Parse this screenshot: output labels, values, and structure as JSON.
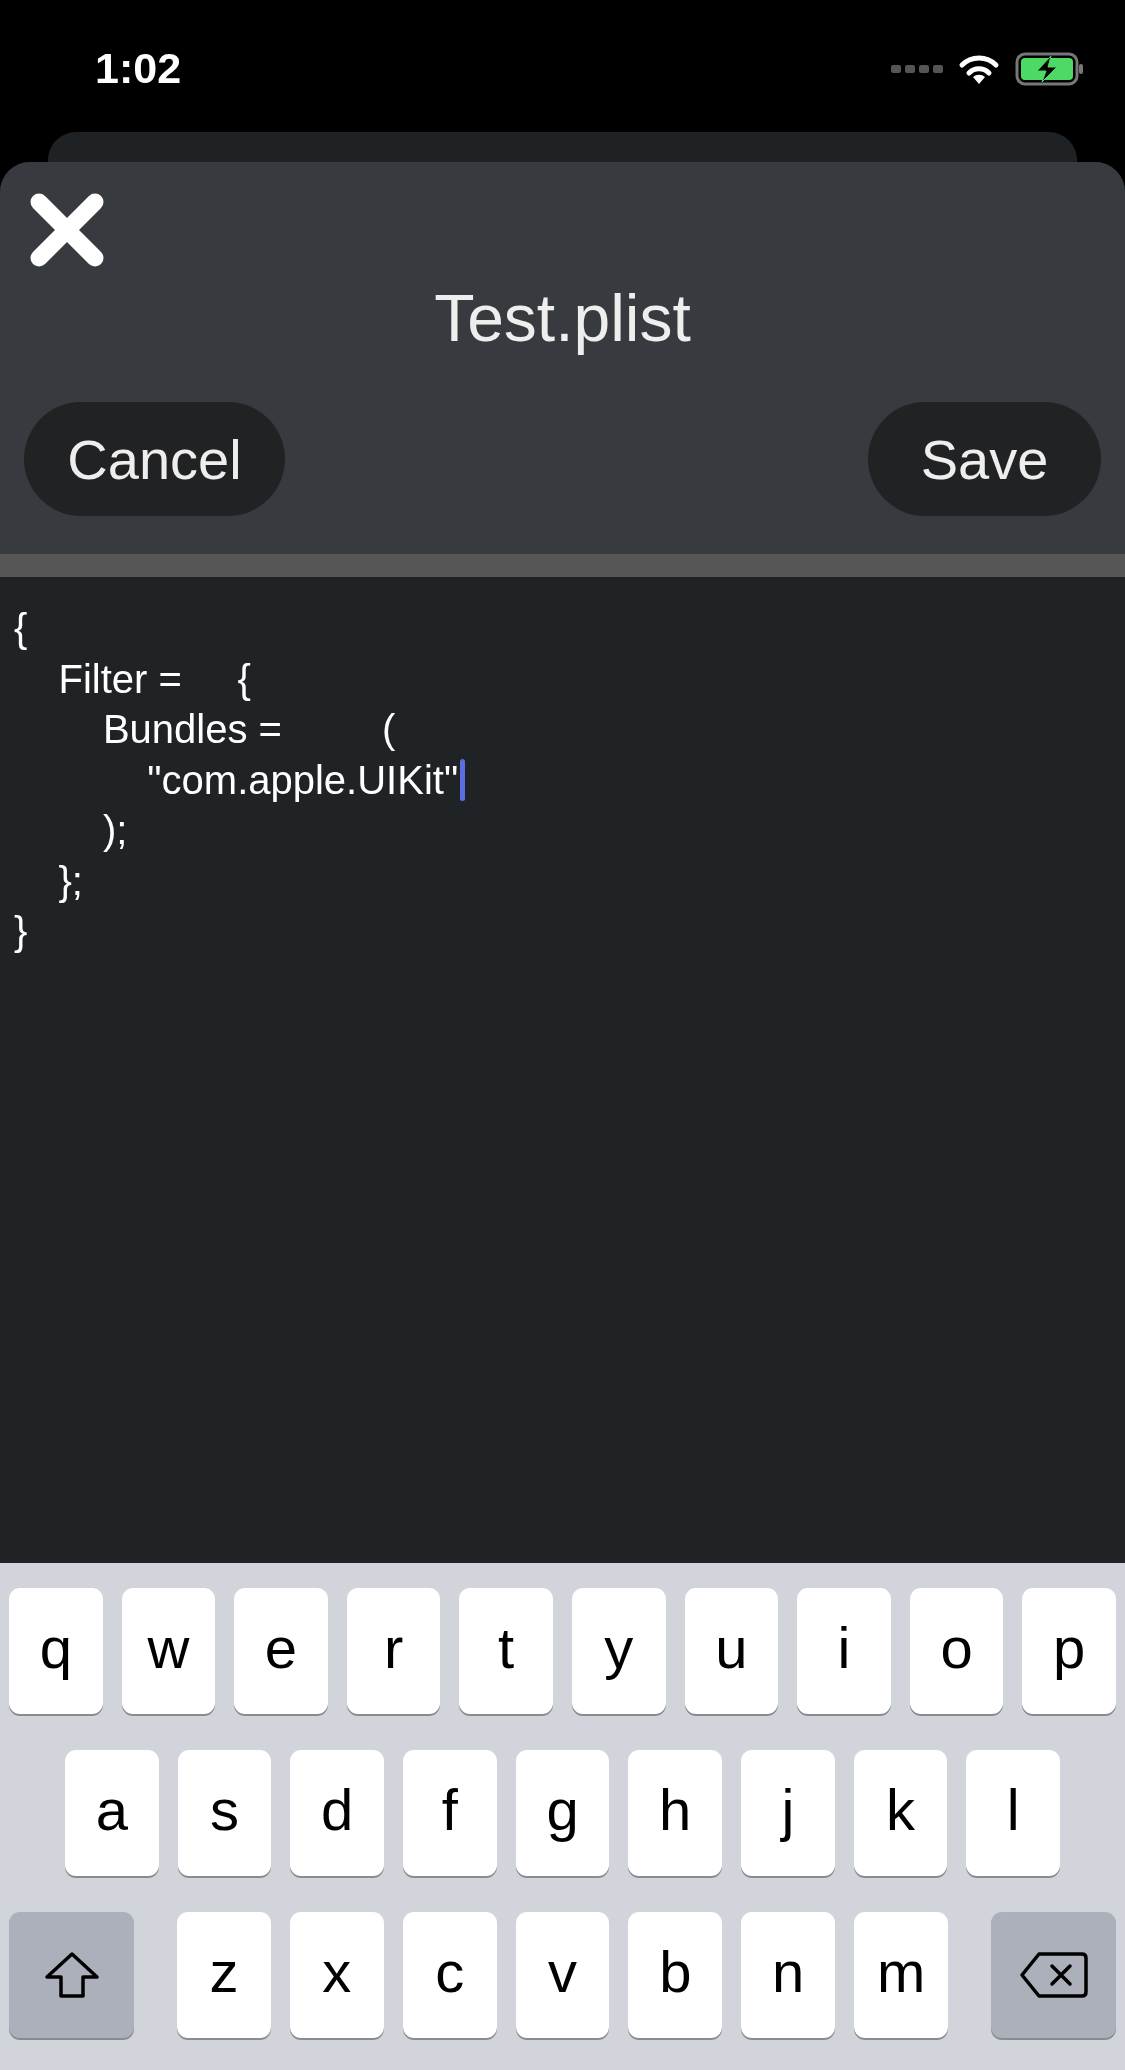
{
  "status_bar": {
    "time": "1:02"
  },
  "sheet": {
    "title": "Test.plist",
    "cancel": "Cancel",
    "save": "Save"
  },
  "editor": {
    "lines": [
      {
        "text": "{",
        "cursor": false
      },
      {
        "text": "    Filter =     {",
        "cursor": false
      },
      {
        "text": "        Bundles =         (",
        "cursor": false
      },
      {
        "text": "            \"com.apple.UIKit\"",
        "cursor": true
      },
      {
        "text": "        );",
        "cursor": false
      },
      {
        "text": "    };",
        "cursor": false
      },
      {
        "text": "}",
        "cursor": false
      }
    ]
  },
  "keyboard": {
    "rows": [
      {
        "keys": [
          {
            "kind": "letter",
            "label": "q"
          },
          {
            "kind": "letter",
            "label": "w"
          },
          {
            "kind": "letter",
            "label": "e"
          },
          {
            "kind": "letter",
            "label": "r"
          },
          {
            "kind": "letter",
            "label": "t"
          },
          {
            "kind": "letter",
            "label": "y"
          },
          {
            "kind": "letter",
            "label": "u"
          },
          {
            "kind": "letter",
            "label": "i"
          },
          {
            "kind": "letter",
            "label": "o"
          },
          {
            "kind": "letter",
            "label": "p"
          }
        ]
      },
      {
        "keys": [
          {
            "kind": "letter",
            "label": "a"
          },
          {
            "kind": "letter",
            "label": "s"
          },
          {
            "kind": "letter",
            "label": "d"
          },
          {
            "kind": "letter",
            "label": "f"
          },
          {
            "kind": "letter",
            "label": "g"
          },
          {
            "kind": "letter",
            "label": "h"
          },
          {
            "kind": "letter",
            "label": "j"
          },
          {
            "kind": "letter",
            "label": "k"
          },
          {
            "kind": "letter",
            "label": "l"
          }
        ]
      },
      {
        "keys": [
          {
            "kind": "shift"
          },
          {
            "kind": "letter",
            "label": "z"
          },
          {
            "kind": "letter",
            "label": "x"
          },
          {
            "kind": "letter",
            "label": "c"
          },
          {
            "kind": "letter",
            "label": "v"
          },
          {
            "kind": "letter",
            "label": "b"
          },
          {
            "kind": "letter",
            "label": "n"
          },
          {
            "kind": "letter",
            "label": "m"
          },
          {
            "kind": "delete"
          }
        ]
      }
    ]
  }
}
